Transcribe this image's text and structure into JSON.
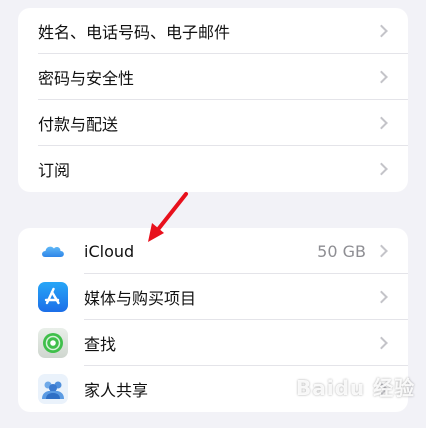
{
  "group1": {
    "items": [
      {
        "label": "姓名、电话号码、电子邮件"
      },
      {
        "label": "密码与安全性"
      },
      {
        "label": "付款与配送"
      },
      {
        "label": "订阅"
      }
    ]
  },
  "group2": {
    "items": [
      {
        "label": "iCloud",
        "value": "50 GB",
        "icon": "icloud-icon"
      },
      {
        "label": "媒体与购买项目",
        "icon": "app-store-icon"
      },
      {
        "label": "查找",
        "icon": "find-my-icon"
      },
      {
        "label": "家人共享",
        "icon": "family-sharing-icon"
      }
    ]
  },
  "annotation": {
    "color": "#e8101c",
    "icon": "red-arrow-icon"
  },
  "watermark": {
    "text": "Baidu 经验"
  }
}
